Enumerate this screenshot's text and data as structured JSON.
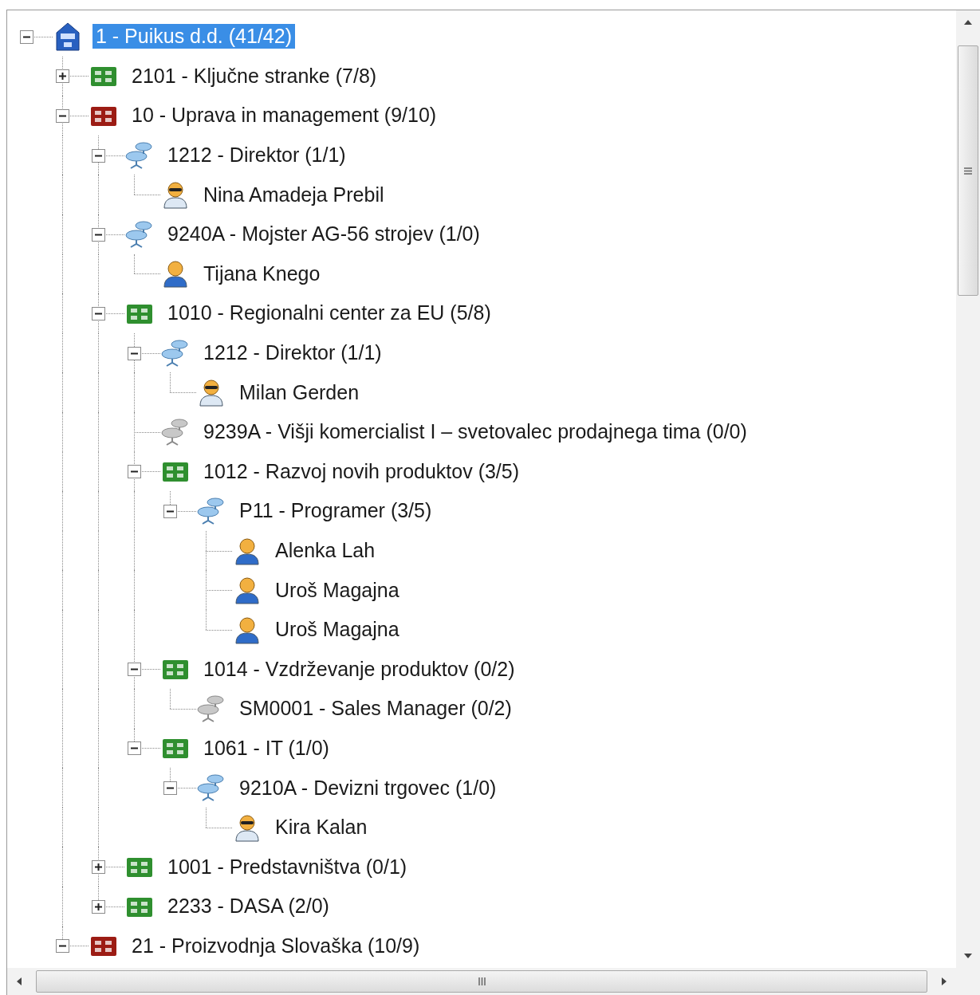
{
  "tree": [
    {
      "kind": "company",
      "label": "1 - Puikus d.d. (41/42)",
      "selected": true,
      "expanded": true,
      "children": [
        {
          "kind": "unit",
          "color": "#2f8f2f",
          "label": "2101 - Ključne stranke (7/8)",
          "selected": false,
          "expanded": false
        },
        {
          "kind": "unit",
          "color": "#9c1c14",
          "label": "10 - Uprava in management (9/10)",
          "selected": false,
          "expanded": true,
          "children": [
            {
              "kind": "position",
              "vacant": false,
              "label": "1212 - Direktor (1/1)",
              "selected": false,
              "expanded": true,
              "children": [
                {
                  "kind": "executive",
                  "label": "Nina Amadeja Prebil",
                  "selected": false
                }
              ]
            },
            {
              "kind": "position",
              "vacant": false,
              "label": "9240A - Mojster AG-56 strojev (1/0)",
              "selected": false,
              "expanded": true,
              "children": [
                {
                  "kind": "employee",
                  "label": "Tijana Knego",
                  "selected": false
                }
              ]
            },
            {
              "kind": "unit",
              "color": "#2f8f2f",
              "label": "1010 - Regionalni center za EU (5/8)",
              "selected": false,
              "expanded": true,
              "children": [
                {
                  "kind": "position",
                  "vacant": false,
                  "label": "1212 - Direktor (1/1)",
                  "selected": false,
                  "expanded": true,
                  "children": [
                    {
                      "kind": "executive",
                      "label": "Milan Gerden",
                      "selected": false
                    }
                  ]
                },
                {
                  "kind": "position",
                  "vacant": true,
                  "label": "9239A - Višji komercialist I – svetovalec prodajnega tima (0/0)",
                  "selected": false
                },
                {
                  "kind": "unit",
                  "color": "#2f8f2f",
                  "label": "1012 - Razvoj novih produktov (3/5)",
                  "selected": false,
                  "expanded": true,
                  "children": [
                    {
                      "kind": "position",
                      "vacant": false,
                      "label": "P11 - Programer (3/5)",
                      "selected": false,
                      "expanded": true,
                      "children": [
                        {
                          "kind": "employee",
                          "label": "Alenka Lah",
                          "selected": false
                        },
                        {
                          "kind": "employee",
                          "label": "Uroš Magajna",
                          "selected": false
                        },
                        {
                          "kind": "employee",
                          "label": "Uroš Magajna",
                          "selected": false
                        }
                      ]
                    }
                  ]
                },
                {
                  "kind": "unit",
                  "color": "#2f8f2f",
                  "label": "1014 - Vzdrževanje produktov (0/2)",
                  "selected": false,
                  "expanded": true,
                  "children": [
                    {
                      "kind": "position",
                      "vacant": true,
                      "label": "SM0001 - Sales Manager (0/2)",
                      "selected": false
                    }
                  ]
                },
                {
                  "kind": "unit",
                  "color": "#2f8f2f",
                  "label": "1061 - IT (1/0)",
                  "selected": false,
                  "expanded": true,
                  "children": [
                    {
                      "kind": "position",
                      "vacant": false,
                      "label": "9210A - Devizni trgovec (1/0)",
                      "selected": false,
                      "expanded": true,
                      "children": [
                        {
                          "kind": "executive",
                          "label": "Kira Kalan",
                          "selected": false
                        }
                      ]
                    }
                  ]
                }
              ]
            },
            {
              "kind": "unit",
              "color": "#2f8f2f",
              "label": "1001 - Predstavništva (0/1)",
              "selected": false,
              "expanded": false
            },
            {
              "kind": "unit",
              "color": "#2f8f2f",
              "label": "2233 - DASA (2/0)",
              "selected": false,
              "expanded": false
            }
          ]
        },
        {
          "kind": "unit",
          "color": "#9c1c14",
          "label": "21 - Proizvodnja Slovaška (10/9)",
          "selected": false,
          "expanded": true
        }
      ]
    }
  ]
}
